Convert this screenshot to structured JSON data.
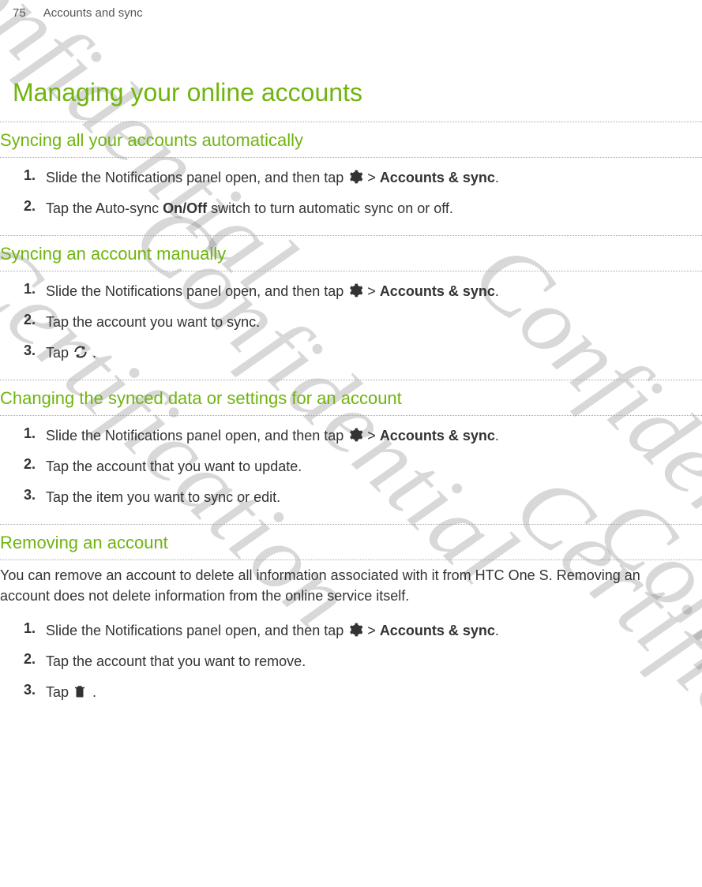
{
  "header": {
    "page_number": "75",
    "breadcrumb": "Accounts and sync"
  },
  "title": "Managing your online accounts",
  "sections": {
    "sync_all": {
      "title": "Syncing all your accounts automatically",
      "steps": {
        "s1_num": "1.",
        "s1_a": "Slide the Notifications panel open, and then tap ",
        "s1_b": " > ",
        "s1_c": "Accounts & sync",
        "s1_d": ".",
        "s2_num": "2.",
        "s2_a": "Tap the Auto-sync ",
        "s2_b": "On/Off",
        "s2_c": " switch to turn automatic sync on or off."
      }
    },
    "sync_manual": {
      "title": "Syncing an account manually",
      "steps": {
        "s1_num": "1.",
        "s1_a": "Slide the Notifications panel open, and then tap ",
        "s1_b": " > ",
        "s1_c": "Accounts & sync",
        "s1_d": ".",
        "s2_num": "2.",
        "s2_a": "Tap the account you want to sync.",
        "s3_num": "3.",
        "s3_a": "Tap ",
        "s3_b": "."
      }
    },
    "change_settings": {
      "title": "Changing the synced data or settings for an account",
      "steps": {
        "s1_num": "1.",
        "s1_a": "Slide the Notifications panel open, and then tap ",
        "s1_b": " > ",
        "s1_c": "Accounts & sync",
        "s1_d": ".",
        "s2_num": "2.",
        "s2_a": "Tap the account that you want to update.",
        "s3_num": "3.",
        "s3_a": "Tap the item you want to sync or edit."
      }
    },
    "remove": {
      "title": "Removing an account",
      "intro": "You can remove an account to delete all information associated with it from HTC One S. Removing an account does not delete information from the online service itself.",
      "steps": {
        "s1_num": "1.",
        "s1_a": "Slide the Notifications panel open, and then tap ",
        "s1_b": " > ",
        "s1_c": "Accounts & sync",
        "s1_d": ".",
        "s2_num": "2.",
        "s2_a": "Tap the account that you want to remove.",
        "s3_num": "3.",
        "s3_a": "Tap ",
        "s3_b": "."
      }
    }
  },
  "watermarks": {
    "confidential": "Confidential",
    "certification": "Certification",
    "confide": "Confide"
  }
}
